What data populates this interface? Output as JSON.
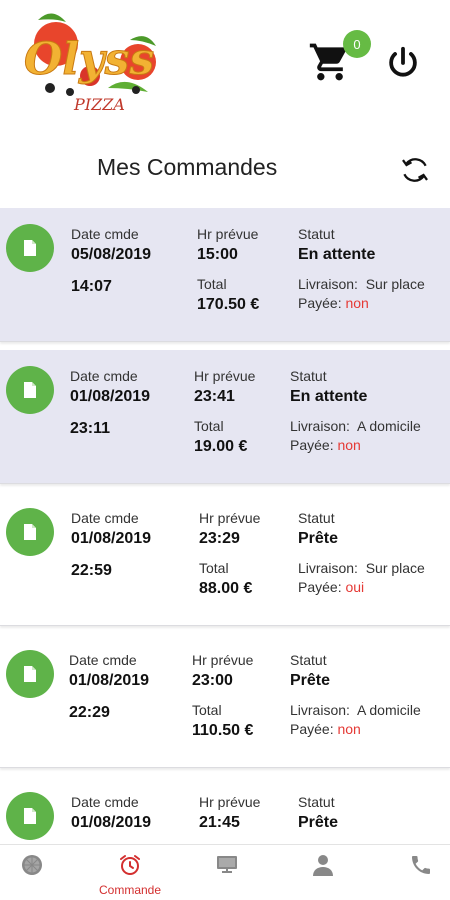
{
  "header": {
    "logo_text": "Olyss",
    "logo_subtext": "PIZZA",
    "cart_count": "0"
  },
  "page": {
    "title": "Mes Commandes"
  },
  "labels": {
    "date": "Date cmde",
    "hour": "Hr prévue",
    "status": "Statut",
    "total": "Total",
    "delivery": "Livraison:",
    "paid": "Payée:"
  },
  "orders": [
    {
      "date": "05/08/2019",
      "time": "14:07",
      "hour": "15:00",
      "total": "170.50 €",
      "status": "En attente",
      "delivery": "Sur place",
      "paid": "non"
    },
    {
      "date": "01/08/2019",
      "time": "23:11",
      "hour": "23:41",
      "total": "19.00 €",
      "status": "En attente",
      "delivery": "A domicile",
      "paid": "non"
    },
    {
      "date": "01/08/2019",
      "time": "22:59",
      "hour": "23:29",
      "total": "88.00 €",
      "status": "Prête",
      "delivery": "Sur place",
      "paid": "oui"
    },
    {
      "date": "01/08/2019",
      "time": "22:29",
      "hour": "23:00",
      "total": "110.50 €",
      "status": "Prête",
      "delivery": "A domicile",
      "paid": "non"
    },
    {
      "date": "01/08/2019",
      "time": "",
      "hour": "21:45",
      "total": "",
      "status": "Prête",
      "delivery": "",
      "paid": ""
    }
  ],
  "nav": {
    "items": [
      {
        "icon": "pizza-icon",
        "label": ""
      },
      {
        "icon": "alarm-clock-icon",
        "label": "Commande"
      },
      {
        "icon": "monitor-icon",
        "label": ""
      },
      {
        "icon": "user-icon",
        "label": ""
      },
      {
        "icon": "phone-icon",
        "label": ""
      }
    ]
  },
  "colors": {
    "accent_green": "#5fb349",
    "badge_green": "#66bb44",
    "pending_bg": "#e6e6f2",
    "alert_red": "#e53935",
    "nav_active": "#d32f2f"
  }
}
